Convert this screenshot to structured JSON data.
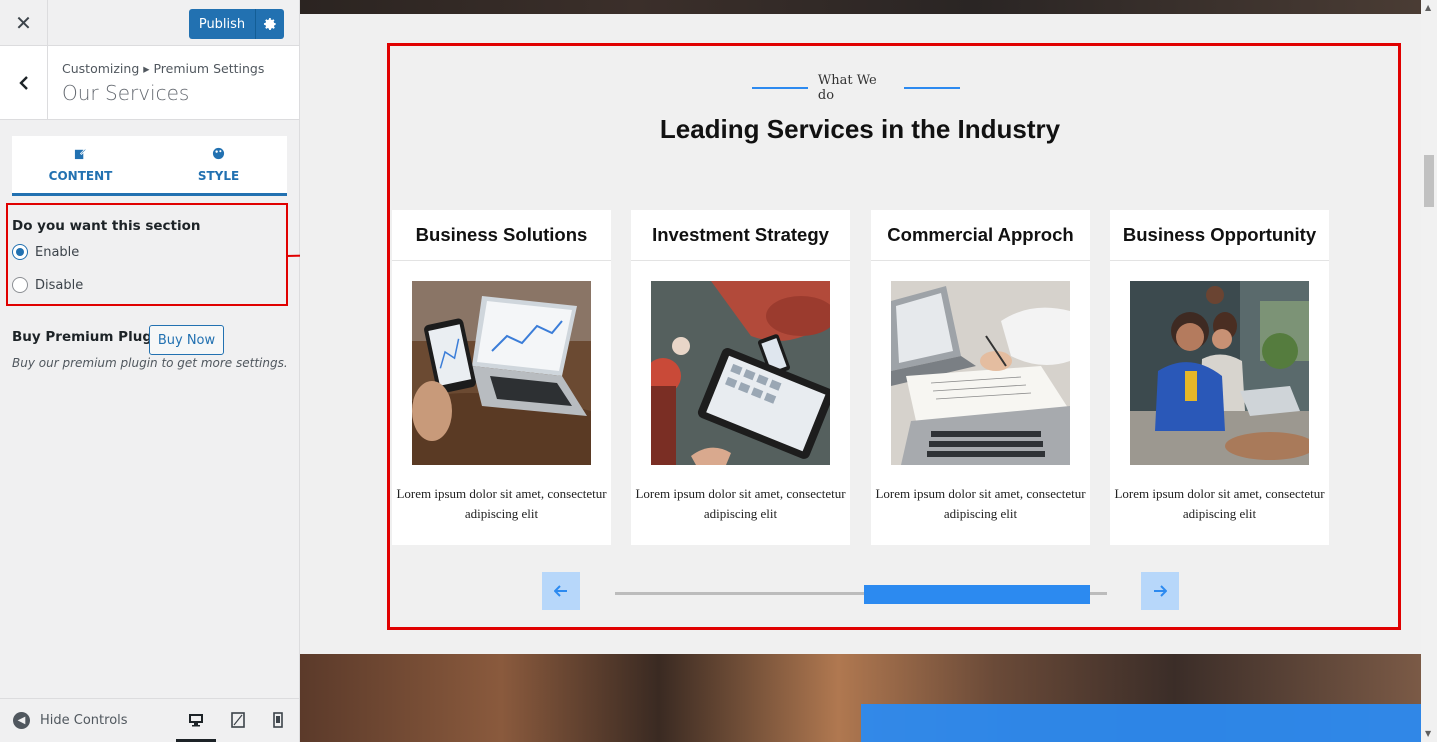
{
  "sidebar": {
    "close_label": "✕",
    "publish_label": "Publish",
    "breadcrumb": "Customizing ▸ Premium Settings",
    "section_title": "Our Services",
    "tabs": [
      {
        "label": "CONTENT",
        "icon": "edit-icon"
      },
      {
        "label": "STYLE",
        "icon": "palette-icon"
      }
    ],
    "enable_question": "Do you want this section",
    "options": [
      {
        "label": "Enable",
        "checked": true
      },
      {
        "label": "Disable",
        "checked": false
      }
    ],
    "premium_label": "Buy Premium Plugin",
    "buy_button": "Buy Now",
    "premium_description": "Buy our premium plugin to get more settings.",
    "hide_controls": "Hide Controls"
  },
  "preview": {
    "eyebrow": "What We do",
    "heading": "Leading Services in the Industry",
    "cards": [
      {
        "title": "Business Solutions",
        "text": "Lorem ipsum dolor sit amet, consectetur adipiscing elit"
      },
      {
        "title": "Investment Strategy",
        "text": "Lorem ipsum dolor sit amet, consectetur adipiscing elit"
      },
      {
        "title": "Commercial Approch",
        "text": "Lorem ipsum dolor sit amet, consectetur adipiscing elit"
      },
      {
        "title": "Business Opportunity",
        "text": "Lorem ipsum dolor sit amet, consectetur adipiscing elit"
      }
    ],
    "colors": {
      "accent": "#2c8af0",
      "highlight": "#e00000",
      "wp_blue": "#2271b1"
    }
  }
}
